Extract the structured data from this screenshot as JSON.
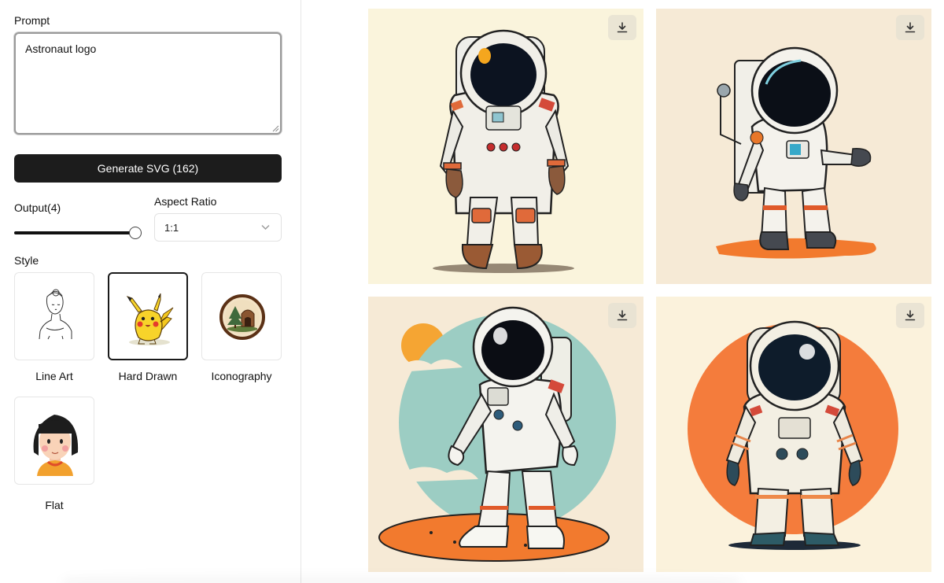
{
  "prompt": {
    "label": "Prompt",
    "value": "Astronaut logo"
  },
  "generate_button": {
    "label": "Generate SVG (162)"
  },
  "output": {
    "label": "Output(4)",
    "value": 4,
    "fraction": 1.0
  },
  "aspect_ratio": {
    "label": "Aspect Ratio",
    "selected": "1:1"
  },
  "style": {
    "label": "Style",
    "options": [
      {
        "name": "Line Art",
        "selected": false
      },
      {
        "name": "Hard Drawn",
        "selected": true
      },
      {
        "name": "Iconography",
        "selected": false
      },
      {
        "name": "Flat",
        "selected": false
      }
    ]
  },
  "results": {
    "download_icon": "download-icon",
    "tiles": [
      {
        "bg": "#faf4dc"
      },
      {
        "bg": "#f6ead6"
      },
      {
        "bg": "#f6ead6"
      },
      {
        "bg": "#fbf2dc"
      }
    ]
  },
  "colors": {
    "button_bg": "#1c1c1c",
    "accent_orange": "#f47c3c",
    "teal": "#9ccdc3"
  }
}
